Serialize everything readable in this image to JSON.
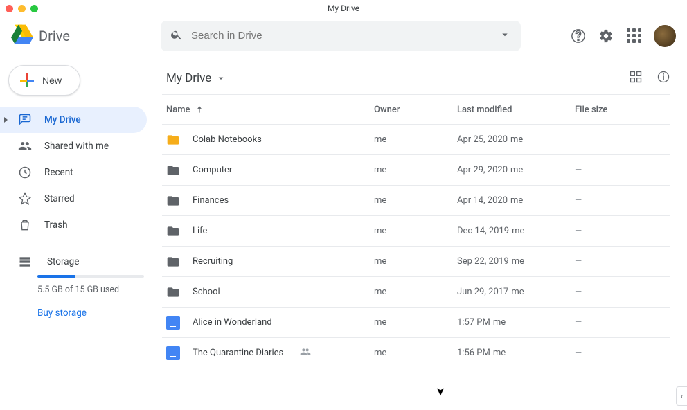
{
  "window": {
    "title": "My Drive"
  },
  "header": {
    "product": "Drive",
    "search_placeholder": "Search in Drive"
  },
  "sidebar": {
    "new_label": "New",
    "items": [
      {
        "label": "My Drive"
      },
      {
        "label": "Shared with me"
      },
      {
        "label": "Recent"
      },
      {
        "label": "Starred"
      },
      {
        "label": "Trash"
      }
    ],
    "storage": {
      "label": "Storage",
      "used_text": "5.5 GB of 15 GB used",
      "percent": 36,
      "buy_label": "Buy storage"
    }
  },
  "main": {
    "path_title": "My Drive",
    "columns": {
      "name": "Name",
      "owner": "Owner",
      "modified": "Last modified",
      "size": "File size"
    },
    "rows": [
      {
        "type": "folder",
        "color": "yellow",
        "name": "Colab Notebooks",
        "owner": "me",
        "modified": "Apr 25, 2020",
        "modified_by": "me",
        "size": "—",
        "shared": false
      },
      {
        "type": "folder",
        "color": "gray",
        "name": "Computer",
        "owner": "me",
        "modified": "Apr 29, 2020",
        "modified_by": "me",
        "size": "—",
        "shared": false
      },
      {
        "type": "folder",
        "color": "gray",
        "name": "Finances",
        "owner": "me",
        "modified": "Apr 14, 2020",
        "modified_by": "me",
        "size": "—",
        "shared": false
      },
      {
        "type": "folder",
        "color": "gray",
        "name": "Life",
        "owner": "me",
        "modified": "Dec 14, 2019",
        "modified_by": "me",
        "size": "—",
        "shared": false
      },
      {
        "type": "folder",
        "color": "gray",
        "name": "Recruiting",
        "owner": "me",
        "modified": "Sep 22, 2019",
        "modified_by": "me",
        "size": "—",
        "shared": false
      },
      {
        "type": "folder",
        "color": "gray",
        "name": "School",
        "owner": "me",
        "modified": "Jun 29, 2017",
        "modified_by": "me",
        "size": "—",
        "shared": false
      },
      {
        "type": "doc",
        "name": "Alice in Wonderland",
        "owner": "me",
        "modified": "1:57 PM",
        "modified_by": "me",
        "size": "—",
        "shared": false
      },
      {
        "type": "doc",
        "name": "The Quarantine Diaries",
        "owner": "me",
        "modified": "1:56 PM",
        "modified_by": "me",
        "size": "—",
        "shared": true
      }
    ]
  }
}
